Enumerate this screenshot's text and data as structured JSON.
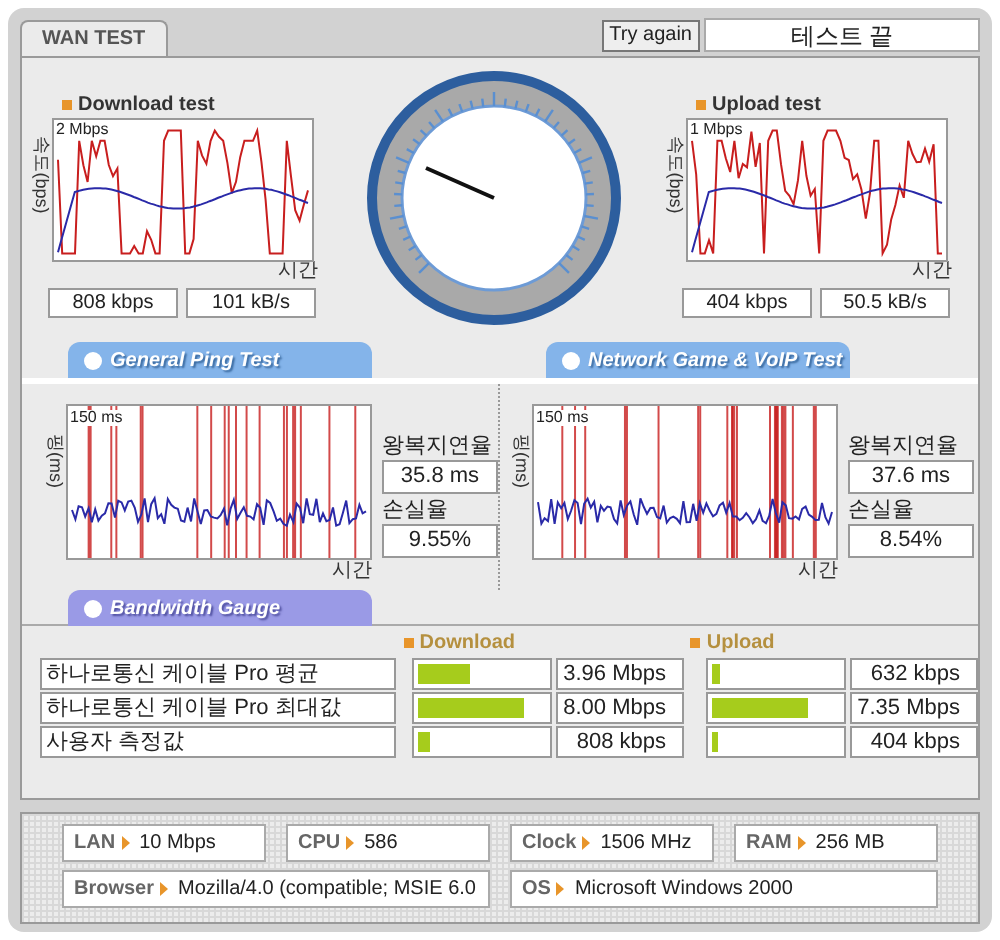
{
  "tabs": [
    {
      "label": "WAN TEST",
      "selected": true
    }
  ],
  "try_again_button": "Try again",
  "status": "테스트 끝",
  "speed_tests": [
    {
      "title": "Download test",
      "y_label": "속도(bps)",
      "scale": "2 Mbps",
      "x_label": "시간",
      "readings": [
        "808 kbps",
        "101 kB/s"
      ]
    },
    {
      "title": "Upload test",
      "y_label": "속도(bps)",
      "scale": "1 Mbps",
      "x_label": "시간",
      "readings": [
        "404 kbps",
        "50.5 kB/s"
      ]
    }
  ],
  "ping_tests": [
    {
      "title": "General Ping Test",
      "y_label": "핑(ms)",
      "scale": "150 ms",
      "x_label": "시간",
      "latency_label": "왕복지연율",
      "latency": "35.8 ms",
      "loss_label": "손실율",
      "loss": "9.55%"
    },
    {
      "title": "Network Game & VoIP Test",
      "y_label": "핑(ms)",
      "scale": "150 ms",
      "x_label": "시간",
      "latency_label": "왕복지연율",
      "latency": "37.6 ms",
      "loss_label": "손실율",
      "loss": "8.54%"
    }
  ],
  "bandwidth": {
    "title": "Bandwidth Gauge",
    "columns": [
      "Download",
      "Upload"
    ],
    "rows": [
      {
        "name": "하나로통신 케이블 Pro 평균",
        "download": {
          "level": 0.4,
          "reading": "3.96 Mbps"
        },
        "upload": {
          "level": 0.06,
          "reading": "632 kbps"
        }
      },
      {
        "name": "하나로통신 케이블 Pro 최대값",
        "download": {
          "level": 0.83,
          "reading": "8.00 Mbps"
        },
        "upload": {
          "level": 0.75,
          "reading": "7.35 Mbps"
        }
      },
      {
        "name": "사용자 측정값",
        "download": {
          "level": 0.09,
          "reading": "808 kbps"
        },
        "upload": {
          "level": 0.05,
          "reading": "404 kbps"
        }
      }
    ]
  },
  "system_info": [
    [
      {
        "label": "LAN",
        "value": "10 Mbps"
      },
      {
        "label": "CPU",
        "value": "586"
      },
      {
        "label": "Clock",
        "value": "1506 MHz"
      },
      {
        "label": "RAM",
        "value": "256 MB"
      }
    ],
    [
      {
        "label": "Browser",
        "value": "Mozilla/4.0 (compatible; MSIE 6.0"
      },
      {
        "label": "OS",
        "value": "Microsoft Windows 2000"
      }
    ]
  ]
}
